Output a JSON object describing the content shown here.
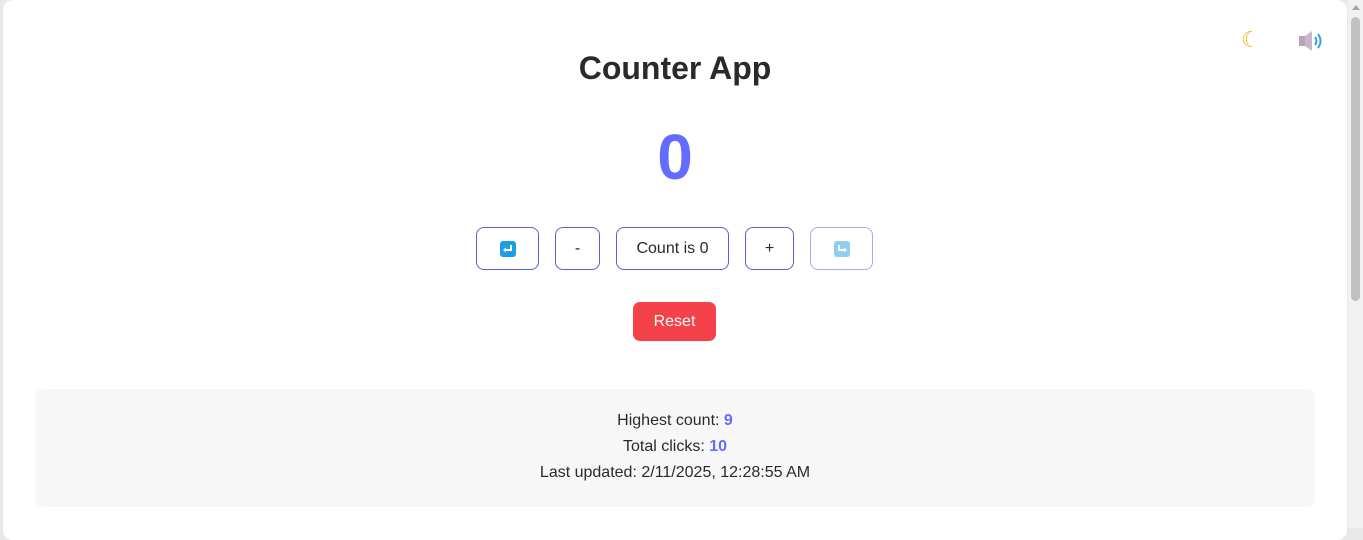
{
  "header": {
    "title": "Counter App",
    "theme_icon": "moon-icon",
    "sound_icon": "speaker-icon"
  },
  "counter": {
    "value": "0",
    "undo_icon": "undo-icon",
    "decrement_label": "-",
    "status_label": "Count is 0",
    "increment_label": "+",
    "redo_icon": "redo-icon",
    "reset_label": "Reset"
  },
  "stats": {
    "highest_label": "Highest count:",
    "highest_value": "9",
    "clicks_label": "Total clicks:",
    "clicks_value": "10",
    "updated_label": "Last updated:",
    "updated_value": "2/11/2025, 12:28:55 AM"
  },
  "colors": {
    "accent": "#646cff",
    "reset": "#f5424a",
    "undo_icon": "#1a9ee5",
    "moon": "#f2b51e"
  }
}
